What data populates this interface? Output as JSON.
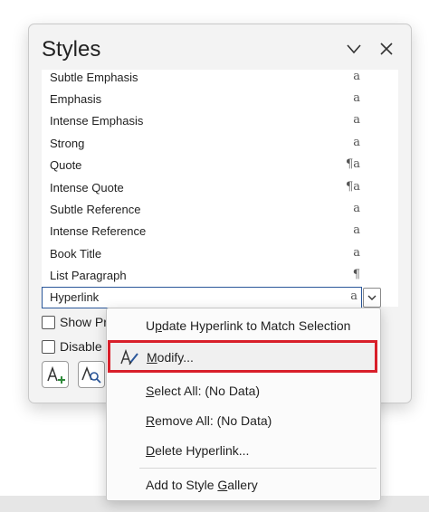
{
  "pane": {
    "title": "Styles",
    "styles": [
      {
        "name": "Subtle Emphasis",
        "mark": "a"
      },
      {
        "name": "Emphasis",
        "mark": "a"
      },
      {
        "name": "Intense Emphasis",
        "mark": "a"
      },
      {
        "name": "Strong",
        "mark": "a"
      },
      {
        "name": "Quote",
        "mark": "¶a"
      },
      {
        "name": "Intense Quote",
        "mark": "¶a"
      },
      {
        "name": "Subtle Reference",
        "mark": "a"
      },
      {
        "name": "Intense Reference",
        "mark": "a"
      },
      {
        "name": "Book Title",
        "mark": "a"
      },
      {
        "name": "List Paragraph",
        "mark": "¶"
      }
    ],
    "selected_style": {
      "name": "Hyperlink",
      "mark": "a"
    },
    "show_preview_label": "Show Pr",
    "disable_label": "Disable"
  },
  "context_menu": {
    "update": {
      "pre": "U",
      "ul": "p",
      "post": "date Hyperlink to Match Selection"
    },
    "modify": {
      "pre": "",
      "ul": "M",
      "post": "odify..."
    },
    "select_all": {
      "pre": "",
      "ul": "S",
      "post": "elect All: (No Data)"
    },
    "remove_all": {
      "pre": "",
      "ul": "R",
      "post": "emove All: (No Data)"
    },
    "delete": {
      "pre": "",
      "ul": "D",
      "post": "elete Hyperlink..."
    },
    "add_gallery": {
      "pre": "Add to Style ",
      "ul": "G",
      "post": "allery"
    }
  },
  "colors": {
    "highlight_border": "#d81f2a",
    "selected_border": "#2b579a",
    "new_style_plus": "#2f8a3a",
    "inspector_accent": "#2b579a"
  }
}
